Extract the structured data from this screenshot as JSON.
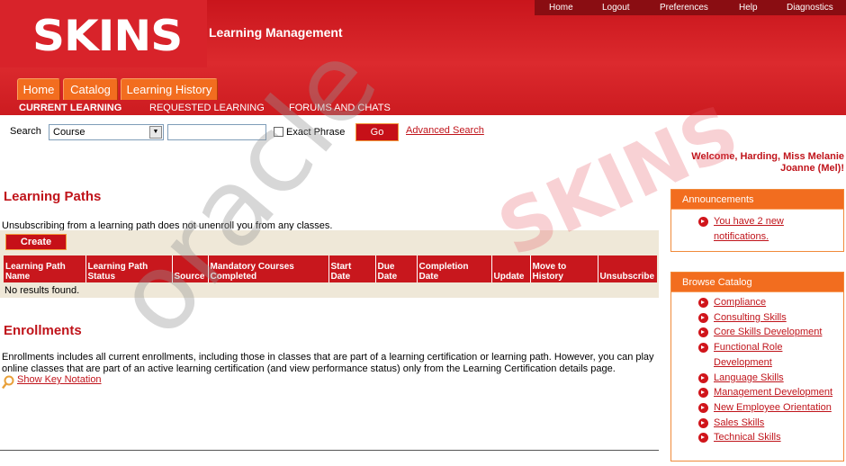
{
  "header": {
    "logo_text": "SKINS",
    "app_title": "Learning Management",
    "top_links": [
      "Home",
      "Logout",
      "Preferences",
      "Help",
      "Diagnostics"
    ],
    "tabs": [
      "Home",
      "Catalog",
      "Learning History"
    ],
    "subnav": [
      "CURRENT LEARNING",
      "REQUESTED LEARNING",
      "FORUMS AND CHATS"
    ]
  },
  "search": {
    "label": "Search",
    "select_value": "Course",
    "input_value": "",
    "exact_phrase_label": "Exact Phrase",
    "go_label": "Go",
    "advanced_label": "Advanced Search"
  },
  "welcome": {
    "line1": "Welcome, Harding, Miss Melanie",
    "line2": "Joanne (Mel)!"
  },
  "learning_paths": {
    "title": "Learning Paths",
    "note": "Unsubscribing from a learning path does not unenroll you from any classes.",
    "create_label": "Create",
    "columns": [
      [
        "Learning Path",
        "Name"
      ],
      [
        "Learning Path",
        "Status"
      ],
      [
        "",
        "Source"
      ],
      [
        "Mandatory Courses",
        "Completed"
      ],
      [
        "Start",
        "Date"
      ],
      [
        "Due",
        "Date"
      ],
      [
        "Completion",
        "Date"
      ],
      [
        "",
        "Update"
      ],
      [
        "Move to",
        "History"
      ],
      [
        "",
        "Unsubscribe"
      ]
    ],
    "empty_text": "No results found."
  },
  "enrollments": {
    "title": "Enrollments",
    "note_line1": "Enrollments includes all current enrollments, including those in classes that are part of a learning certification or learning path. However, you can play",
    "note_line2": "online classes that are part of an active learning certification (and view performance status) only from the Learning Certification details page.",
    "key_link": "Show Key Notation"
  },
  "announcements": {
    "title": "Announcements",
    "items": [
      [
        "You have 2 new",
        "notifications."
      ]
    ]
  },
  "browse_catalog": {
    "title": "Browse Catalog",
    "items": [
      [
        "Compliance"
      ],
      [
        "Consulting Skills"
      ],
      [
        "Core Skills Development"
      ],
      [
        "Functional Role",
        "Development"
      ],
      [
        "Language Skills"
      ],
      [
        "Management Development"
      ],
      [
        "New Employee Orientation"
      ],
      [
        "Sales Skills"
      ],
      [
        "Technical Skills"
      ]
    ]
  },
  "watermarks": {
    "oracle": "oracle",
    "skins": "SKINS"
  },
  "colors": {
    "brand_red": "#d01c22",
    "tab_orange": "#f26d1f",
    "link_red": "#c0141b",
    "panel_beige": "#efe8d8"
  }
}
